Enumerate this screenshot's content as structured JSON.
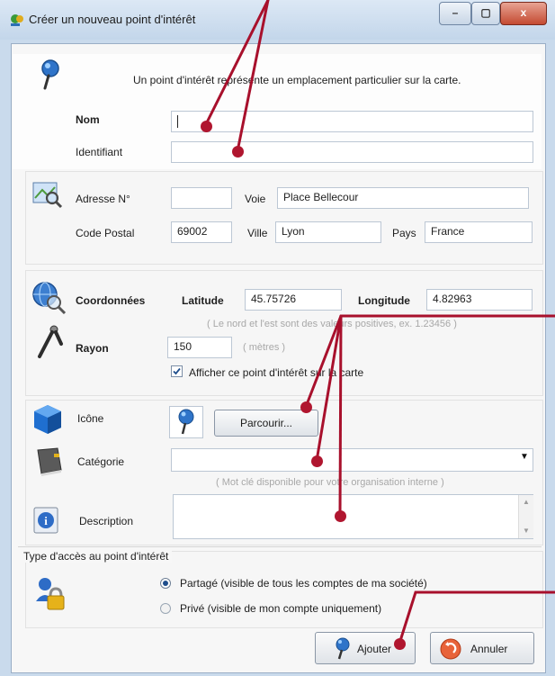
{
  "window": {
    "title": "Créer un nouveau point d'intérêt",
    "min": "–",
    "max": "▢",
    "close": "x"
  },
  "intro": "Un point d'intérêt représente un emplacement particulier sur la carte.",
  "name": {
    "label": "Nom",
    "value": ""
  },
  "identifier": {
    "label": "Identifiant",
    "value": ""
  },
  "address": {
    "number_label": "Adresse N°",
    "number_value": "",
    "street_label": "Voie",
    "street_value": "Place Bellecour",
    "postal_label": "Code Postal",
    "postal_value": "69002",
    "city_label": "Ville",
    "city_value": "Lyon",
    "country_label": "Pays",
    "country_value": "France"
  },
  "coords": {
    "label": "Coordonnées",
    "lat_label": "Latitude",
    "lat_value": "45.75726",
    "lon_label": "Longitude",
    "lon_value": "4.82963",
    "hint": "( Le nord et l'est sont des valeurs positives, ex. 1.23456 )"
  },
  "radius": {
    "label": "Rayon",
    "value": "150",
    "unit": "( mètres )"
  },
  "show_on_map": {
    "label": "Afficher ce point d'intérêt sur la carte",
    "checked": true
  },
  "icon": {
    "label": "Icône",
    "browse": "Parcourir..."
  },
  "category": {
    "label": "Catégorie",
    "value": "",
    "hint": "( Mot clé disponible pour votre organisation interne )"
  },
  "description": {
    "label": "Description",
    "value": ""
  },
  "access": {
    "title": "Type d'accès au point d'intérêt",
    "shared": "Partagé (visible de tous les comptes de ma société)",
    "private": "Privé (visible de mon compte uniquement)",
    "selected": "shared"
  },
  "buttons": {
    "add": "Ajouter",
    "cancel": "Annuler"
  },
  "colors": {
    "annotation": "#a8102c",
    "title_bar": "#c3d6ea"
  },
  "icons": [
    "pin-icon",
    "map-search-icon",
    "globe-search-icon",
    "compass-icon",
    "cube-icon",
    "book-icon",
    "info-icon",
    "access-lock-icon",
    "cancel-icon"
  ]
}
